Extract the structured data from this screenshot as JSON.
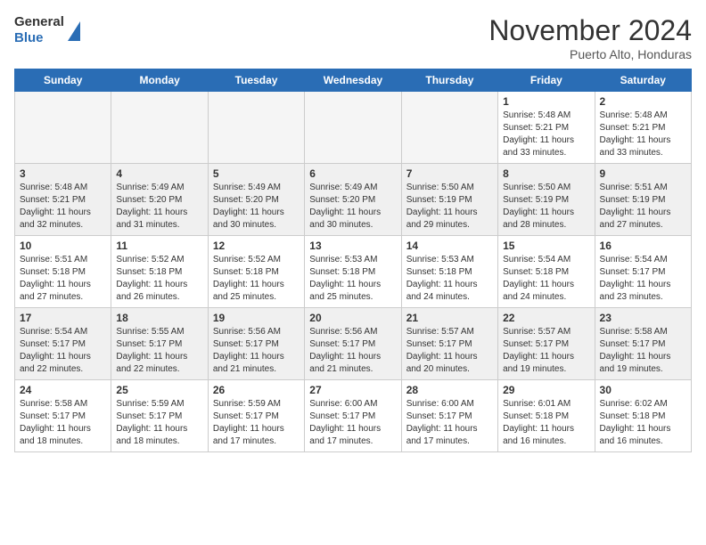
{
  "header": {
    "logo_line1": "General",
    "logo_line2": "Blue",
    "month": "November 2024",
    "location": "Puerto Alto, Honduras"
  },
  "weekdays": [
    "Sunday",
    "Monday",
    "Tuesday",
    "Wednesday",
    "Thursday",
    "Friday",
    "Saturday"
  ],
  "weeks": [
    [
      {
        "day": "",
        "info": "",
        "empty": true
      },
      {
        "day": "",
        "info": "",
        "empty": true
      },
      {
        "day": "",
        "info": "",
        "empty": true
      },
      {
        "day": "",
        "info": "",
        "empty": true
      },
      {
        "day": "",
        "info": "",
        "empty": true
      },
      {
        "day": "1",
        "info": "Sunrise: 5:48 AM\nSunset: 5:21 PM\nDaylight: 11 hours\nand 33 minutes."
      },
      {
        "day": "2",
        "info": "Sunrise: 5:48 AM\nSunset: 5:21 PM\nDaylight: 11 hours\nand 33 minutes."
      }
    ],
    [
      {
        "day": "3",
        "info": "Sunrise: 5:48 AM\nSunset: 5:21 PM\nDaylight: 11 hours\nand 32 minutes."
      },
      {
        "day": "4",
        "info": "Sunrise: 5:49 AM\nSunset: 5:20 PM\nDaylight: 11 hours\nand 31 minutes."
      },
      {
        "day": "5",
        "info": "Sunrise: 5:49 AM\nSunset: 5:20 PM\nDaylight: 11 hours\nand 30 minutes."
      },
      {
        "day": "6",
        "info": "Sunrise: 5:49 AM\nSunset: 5:20 PM\nDaylight: 11 hours\nand 30 minutes."
      },
      {
        "day": "7",
        "info": "Sunrise: 5:50 AM\nSunset: 5:19 PM\nDaylight: 11 hours\nand 29 minutes."
      },
      {
        "day": "8",
        "info": "Sunrise: 5:50 AM\nSunset: 5:19 PM\nDaylight: 11 hours\nand 28 minutes."
      },
      {
        "day": "9",
        "info": "Sunrise: 5:51 AM\nSunset: 5:19 PM\nDaylight: 11 hours\nand 27 minutes."
      }
    ],
    [
      {
        "day": "10",
        "info": "Sunrise: 5:51 AM\nSunset: 5:18 PM\nDaylight: 11 hours\nand 27 minutes."
      },
      {
        "day": "11",
        "info": "Sunrise: 5:52 AM\nSunset: 5:18 PM\nDaylight: 11 hours\nand 26 minutes."
      },
      {
        "day": "12",
        "info": "Sunrise: 5:52 AM\nSunset: 5:18 PM\nDaylight: 11 hours\nand 25 minutes."
      },
      {
        "day": "13",
        "info": "Sunrise: 5:53 AM\nSunset: 5:18 PM\nDaylight: 11 hours\nand 25 minutes."
      },
      {
        "day": "14",
        "info": "Sunrise: 5:53 AM\nSunset: 5:18 PM\nDaylight: 11 hours\nand 24 minutes."
      },
      {
        "day": "15",
        "info": "Sunrise: 5:54 AM\nSunset: 5:18 PM\nDaylight: 11 hours\nand 24 minutes."
      },
      {
        "day": "16",
        "info": "Sunrise: 5:54 AM\nSunset: 5:17 PM\nDaylight: 11 hours\nand 23 minutes."
      }
    ],
    [
      {
        "day": "17",
        "info": "Sunrise: 5:54 AM\nSunset: 5:17 PM\nDaylight: 11 hours\nand 22 minutes."
      },
      {
        "day": "18",
        "info": "Sunrise: 5:55 AM\nSunset: 5:17 PM\nDaylight: 11 hours\nand 22 minutes."
      },
      {
        "day": "19",
        "info": "Sunrise: 5:56 AM\nSunset: 5:17 PM\nDaylight: 11 hours\nand 21 minutes."
      },
      {
        "day": "20",
        "info": "Sunrise: 5:56 AM\nSunset: 5:17 PM\nDaylight: 11 hours\nand 21 minutes."
      },
      {
        "day": "21",
        "info": "Sunrise: 5:57 AM\nSunset: 5:17 PM\nDaylight: 11 hours\nand 20 minutes."
      },
      {
        "day": "22",
        "info": "Sunrise: 5:57 AM\nSunset: 5:17 PM\nDaylight: 11 hours\nand 19 minutes."
      },
      {
        "day": "23",
        "info": "Sunrise: 5:58 AM\nSunset: 5:17 PM\nDaylight: 11 hours\nand 19 minutes."
      }
    ],
    [
      {
        "day": "24",
        "info": "Sunrise: 5:58 AM\nSunset: 5:17 PM\nDaylight: 11 hours\nand 18 minutes."
      },
      {
        "day": "25",
        "info": "Sunrise: 5:59 AM\nSunset: 5:17 PM\nDaylight: 11 hours\nand 18 minutes."
      },
      {
        "day": "26",
        "info": "Sunrise: 5:59 AM\nSunset: 5:17 PM\nDaylight: 11 hours\nand 17 minutes."
      },
      {
        "day": "27",
        "info": "Sunrise: 6:00 AM\nSunset: 5:17 PM\nDaylight: 11 hours\nand 17 minutes."
      },
      {
        "day": "28",
        "info": "Sunrise: 6:00 AM\nSunset: 5:17 PM\nDaylight: 11 hours\nand 17 minutes."
      },
      {
        "day": "29",
        "info": "Sunrise: 6:01 AM\nSunset: 5:18 PM\nDaylight: 11 hours\nand 16 minutes."
      },
      {
        "day": "30",
        "info": "Sunrise: 6:02 AM\nSunset: 5:18 PM\nDaylight: 11 hours\nand 16 minutes."
      }
    ]
  ]
}
